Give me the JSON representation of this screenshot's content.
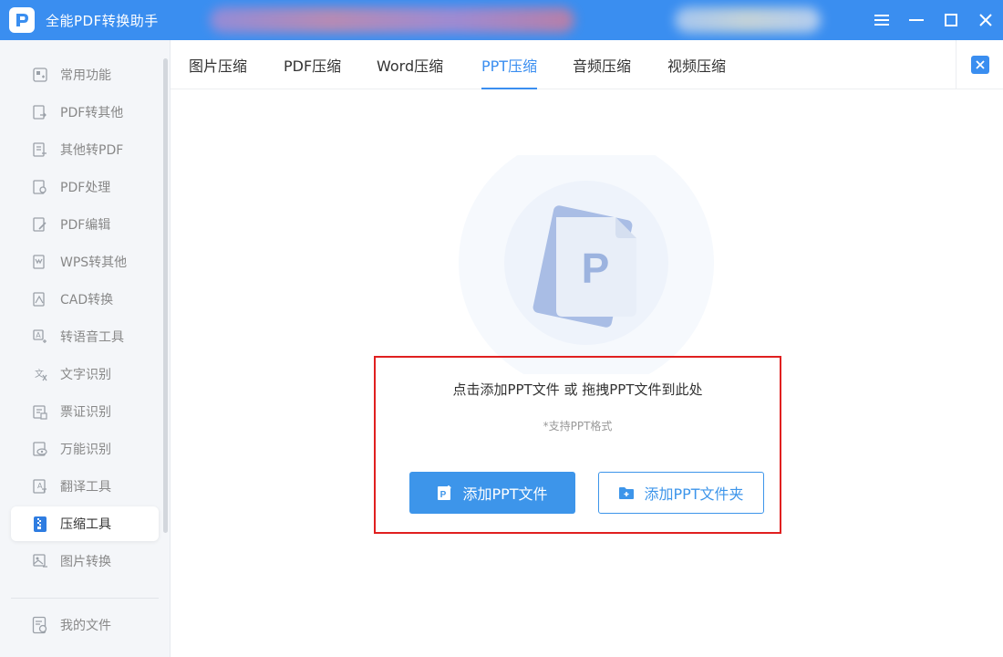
{
  "app": {
    "title": "全能PDF转换助手"
  },
  "sidebar": {
    "items": [
      {
        "label": "常用功能",
        "icon": "common-features-icon"
      },
      {
        "label": "PDF转其他",
        "icon": "pdf-convert-icon"
      },
      {
        "label": "其他转PDF",
        "icon": "to-pdf-icon"
      },
      {
        "label": "PDF处理",
        "icon": "pdf-process-icon"
      },
      {
        "label": "PDF编辑",
        "icon": "pdf-edit-icon"
      },
      {
        "label": "WPS转其他",
        "icon": "wps-convert-icon"
      },
      {
        "label": "CAD转换",
        "icon": "cad-convert-icon"
      },
      {
        "label": "转语音工具",
        "icon": "text-to-speech-icon"
      },
      {
        "label": "文字识别",
        "icon": "text-recognition-icon"
      },
      {
        "label": "票证识别",
        "icon": "ticket-recognition-icon"
      },
      {
        "label": "万能识别",
        "icon": "universal-recognition-icon"
      },
      {
        "label": "翻译工具",
        "icon": "translate-icon"
      },
      {
        "label": "压缩工具",
        "icon": "compress-icon",
        "active": true
      },
      {
        "label": "图片转换",
        "icon": "image-convert-icon"
      }
    ],
    "bottom": {
      "label": "我的文件",
      "icon": "my-files-icon"
    }
  },
  "tabs": [
    {
      "label": "图片压缩"
    },
    {
      "label": "PDF压缩"
    },
    {
      "label": "Word压缩"
    },
    {
      "label": "PPT压缩",
      "active": true
    },
    {
      "label": "音频压缩"
    },
    {
      "label": "视频压缩"
    }
  ],
  "dropzone": {
    "text": "点击添加PPT文件 或 拖拽PPT文件到此处",
    "subtext": "*支持PPT格式",
    "add_file_label": "添加PPT文件",
    "add_folder_label": "添加PPT文件夹"
  },
  "illustration": {
    "letter": "P"
  },
  "colors": {
    "accent": "#3a8ef0",
    "highlight_border": "#e02020"
  }
}
